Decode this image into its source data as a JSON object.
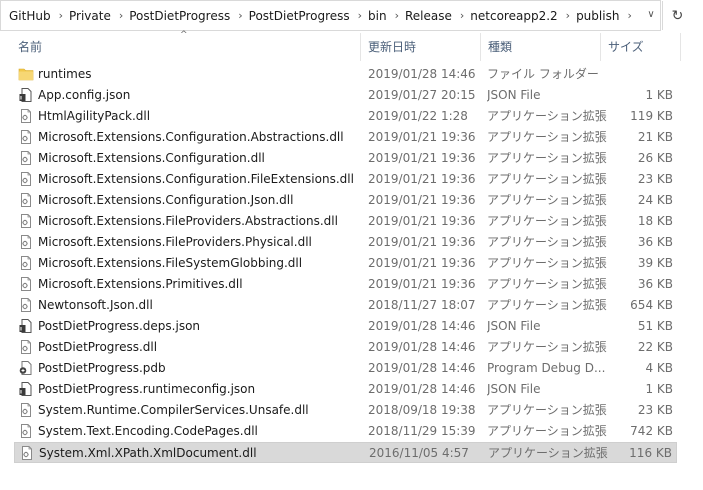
{
  "addressbar": {
    "crumbs": [
      "GitHub",
      "Private",
      "PostDietProgress",
      "PostDietProgress",
      "bin",
      "Release",
      "netcoreapp2.2",
      "publish"
    ],
    "separator": "›",
    "dropdown_glyph": "∨",
    "refresh_glyph": "↻"
  },
  "header": {
    "name": "名前",
    "date": "更新日時",
    "type": "種類",
    "size": "サイズ",
    "sort_glyph": "^"
  },
  "colors": {
    "folder": "#f2c94c",
    "header_text": "#4c607a",
    "meta_text": "#6d6d6d",
    "selected_bg": "#d9d9d9"
  },
  "rows": [
    {
      "name": "runtimes",
      "date": "2019/01/28 14:46",
      "type": "ファイル フォルダー",
      "size": "",
      "icon": "folder-icon"
    },
    {
      "name": "App.config.json",
      "date": "2019/01/27 20:15",
      "type": "JSON File",
      "size": "1 KB",
      "icon": "json-file-icon"
    },
    {
      "name": "HtmlAgilityPack.dll",
      "date": "2019/01/22 1:28",
      "type": "アプリケーション拡張",
      "size": "119 KB",
      "icon": "dll-file-icon"
    },
    {
      "name": "Microsoft.Extensions.Configuration.Abstractions.dll",
      "date": "2019/01/21 19:36",
      "type": "アプリケーション拡張",
      "size": "21 KB",
      "icon": "dll-file-icon"
    },
    {
      "name": "Microsoft.Extensions.Configuration.dll",
      "date": "2019/01/21 19:36",
      "type": "アプリケーション拡張",
      "size": "26 KB",
      "icon": "dll-file-icon"
    },
    {
      "name": "Microsoft.Extensions.Configuration.FileExtensions.dll",
      "date": "2019/01/21 19:36",
      "type": "アプリケーション拡張",
      "size": "23 KB",
      "icon": "dll-file-icon"
    },
    {
      "name": "Microsoft.Extensions.Configuration.Json.dll",
      "date": "2019/01/21 19:36",
      "type": "アプリケーション拡張",
      "size": "24 KB",
      "icon": "dll-file-icon"
    },
    {
      "name": "Microsoft.Extensions.FileProviders.Abstractions.dll",
      "date": "2019/01/21 19:36",
      "type": "アプリケーション拡張",
      "size": "18 KB",
      "icon": "dll-file-icon"
    },
    {
      "name": "Microsoft.Extensions.FileProviders.Physical.dll",
      "date": "2019/01/21 19:36",
      "type": "アプリケーション拡張",
      "size": "36 KB",
      "icon": "dll-file-icon"
    },
    {
      "name": "Microsoft.Extensions.FileSystemGlobbing.dll",
      "date": "2019/01/21 19:36",
      "type": "アプリケーション拡張",
      "size": "39 KB",
      "icon": "dll-file-icon"
    },
    {
      "name": "Microsoft.Extensions.Primitives.dll",
      "date": "2019/01/21 19:36",
      "type": "アプリケーション拡張",
      "size": "36 KB",
      "icon": "dll-file-icon"
    },
    {
      "name": "Newtonsoft.Json.dll",
      "date": "2018/11/27 18:07",
      "type": "アプリケーション拡張",
      "size": "654 KB",
      "icon": "dll-file-icon"
    },
    {
      "name": "PostDietProgress.deps.json",
      "date": "2019/01/28 14:46",
      "type": "JSON File",
      "size": "51 KB",
      "icon": "json-file-icon"
    },
    {
      "name": "PostDietProgress.dll",
      "date": "2019/01/28 14:46",
      "type": "アプリケーション拡張",
      "size": "22 KB",
      "icon": "dll-file-icon"
    },
    {
      "name": "PostDietProgress.pdb",
      "date": "2019/01/28 14:46",
      "type": "Program Debug D...",
      "size": "4 KB",
      "icon": "pdb-file-icon"
    },
    {
      "name": "PostDietProgress.runtimeconfig.json",
      "date": "2019/01/28 14:46",
      "type": "JSON File",
      "size": "1 KB",
      "icon": "json-file-icon"
    },
    {
      "name": "System.Runtime.CompilerServices.Unsafe.dll",
      "date": "2018/09/18 19:38",
      "type": "アプリケーション拡張",
      "size": "23 KB",
      "icon": "dll-file-icon"
    },
    {
      "name": "System.Text.Encoding.CodePages.dll",
      "date": "2018/11/29 15:39",
      "type": "アプリケーション拡張",
      "size": "742 KB",
      "icon": "dll-file-icon"
    },
    {
      "name": "System.Xml.XPath.XmlDocument.dll",
      "date": "2016/11/05 4:57",
      "type": "アプリケーション拡張",
      "size": "116 KB",
      "icon": "dll-file-icon",
      "selected": true
    }
  ]
}
